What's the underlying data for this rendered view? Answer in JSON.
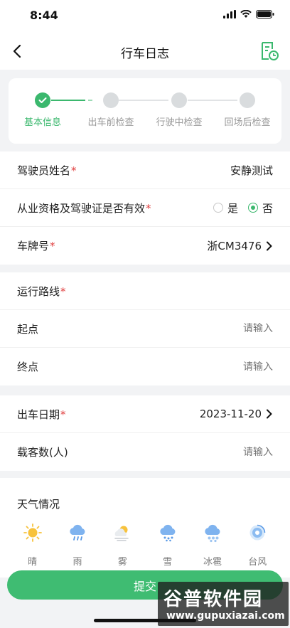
{
  "status_bar": {
    "time": "8:44"
  },
  "nav": {
    "title": "行车日志"
  },
  "steps": [
    {
      "label": "基本信息",
      "active": true
    },
    {
      "label": "出车前检查",
      "active": false
    },
    {
      "label": "行驶中检查",
      "active": false
    },
    {
      "label": "回场后检查",
      "active": false
    }
  ],
  "driver": {
    "name_label": "驾驶员姓名",
    "name_value": "安静测试",
    "license_label": "从业资格及驾驶证是否有效",
    "yes_label": "是",
    "no_label": "否",
    "selected": "否",
    "plate_label": "车牌号",
    "plate_value": "浙CM3476"
  },
  "route": {
    "title_label": "运行路线",
    "start_label": "起点",
    "start_placeholder": "请输入",
    "end_label": "终点",
    "end_placeholder": "请输入"
  },
  "trip": {
    "date_label": "出车日期",
    "date_value": "2023-11-20",
    "passengers_label": "载客数(人)",
    "passengers_placeholder": "请输入"
  },
  "weather": {
    "title": "天气情况",
    "items": [
      {
        "label": "晴",
        "icon": "sunny-icon"
      },
      {
        "label": "雨",
        "icon": "rain-icon"
      },
      {
        "label": "雾",
        "icon": "fog-icon"
      },
      {
        "label": "雪",
        "icon": "snow-icon"
      },
      {
        "label": "冰雹",
        "icon": "hail-icon"
      },
      {
        "label": "台风",
        "icon": "typhoon-icon"
      }
    ]
  },
  "submit_label": "提交",
  "required_mark": "*",
  "watermark": {
    "main": "谷普软件园",
    "sub": "www.gupuxiazai.com"
  },
  "colors": {
    "accent": "#3bb86e",
    "required": "#e04040",
    "background": "#f2f3f5"
  }
}
